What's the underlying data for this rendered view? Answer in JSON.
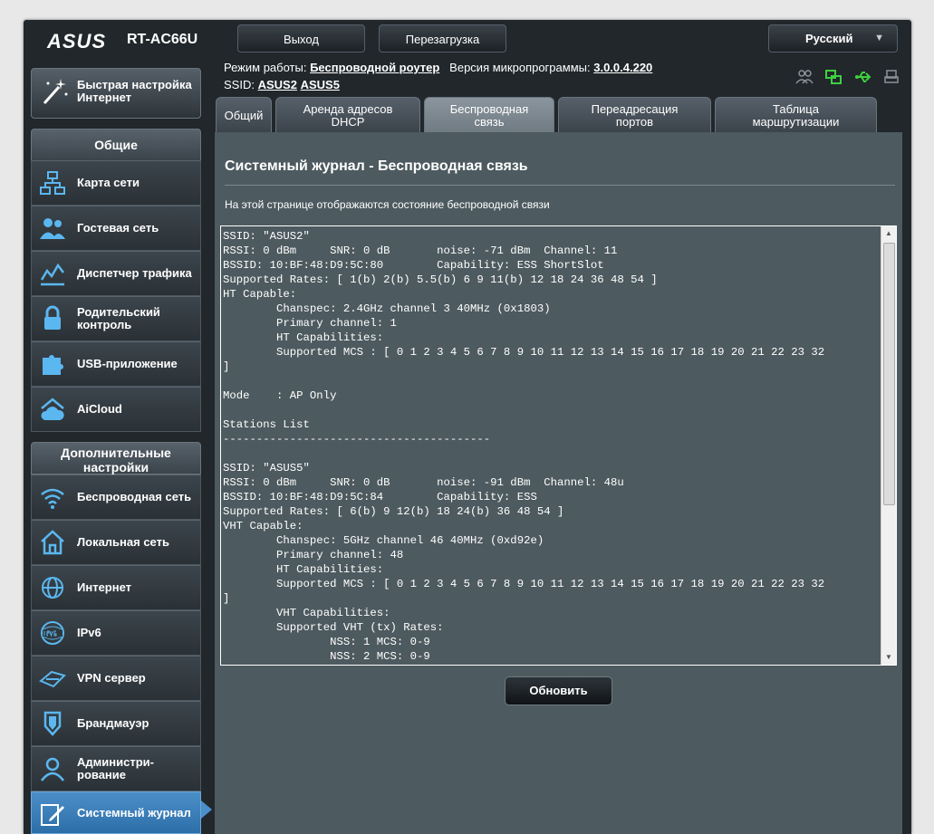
{
  "header": {
    "brand": "ASUS",
    "model": "RT-AC66U",
    "logout_label": "Выход",
    "reboot_label": "Перезагрузка",
    "language": "Русский"
  },
  "info": {
    "mode_label": "Режим работы:",
    "mode_value": "Беспроводной роутер",
    "firmware_label": "Версия микропрограммы:",
    "firmware_value": "3.0.0.4.220",
    "ssid_label": "SSID:",
    "ssid1": "ASUS2",
    "ssid2": "ASUS5"
  },
  "quick_setup": "Быстрая настройка Интернет",
  "sidebar": {
    "general_title": "Общие",
    "general_items": [
      {
        "label": "Карта сети",
        "icon": "network-map-icon"
      },
      {
        "label": "Гостевая сеть",
        "icon": "guest-network-icon"
      },
      {
        "label": "Диспетчер трафика",
        "icon": "traffic-manager-icon"
      },
      {
        "label": "Родительский контроль",
        "icon": "parental-control-icon"
      },
      {
        "label": "USB-приложение",
        "icon": "usb-app-icon"
      },
      {
        "label": "AiCloud",
        "icon": "aicloud-icon"
      }
    ],
    "advanced_title": "Дополнительные настройки",
    "advanced_items": [
      {
        "label": "Беспроводная сеть",
        "icon": "wireless-icon"
      },
      {
        "label": "Локальная сеть",
        "icon": "lan-icon"
      },
      {
        "label": "Интернет",
        "icon": "internet-icon"
      },
      {
        "label": "IPv6",
        "icon": "ipv6-icon"
      },
      {
        "label": "VPN сервер",
        "icon": "vpn-icon"
      },
      {
        "label": "Брандмауэр",
        "icon": "firewall-icon"
      },
      {
        "label": "Администри-рование",
        "icon": "administration-icon"
      },
      {
        "label": "Системный журнал",
        "icon": "system-log-icon"
      }
    ]
  },
  "tabs": [
    {
      "label": "Общий"
    },
    {
      "label": "Аренда адресов DHCP"
    },
    {
      "label": "Беспроводная связь"
    },
    {
      "label": "Переадресация портов"
    },
    {
      "label": "Таблица маршрутизации"
    }
  ],
  "content": {
    "title": "Системный журнал - Беспроводная связь",
    "description": "На этой странице отображаются состояние беспроводной связи",
    "log": "SSID: \"ASUS2\"\nRSSI: 0 dBm     SNR: 0 dB       noise: -71 dBm  Channel: 11\nBSSID: 10:BF:48:D9:5C:80        Capability: ESS ShortSlot\nSupported Rates: [ 1(b) 2(b) 5.5(b) 6 9 11(b) 12 18 24 36 48 54 ]\nHT Capable:\n        Chanspec: 2.4GHz channel 3 40MHz (0x1803)\n        Primary channel: 1\n        HT Capabilities:\n        Supported MCS : [ 0 1 2 3 4 5 6 7 8 9 10 11 12 13 14 15 16 17 18 19 20 21 22 23 32\n]\n\nMode    : AP Only\n\nStations List\n----------------------------------------\n\nSSID: \"ASUS5\"\nRSSI: 0 dBm     SNR: 0 dB       noise: -91 dBm  Channel: 48u\nBSSID: 10:BF:48:D9:5C:84        Capability: ESS\nSupported Rates: [ 6(b) 9 12(b) 18 24(b) 36 48 54 ]\nVHT Capable:\n        Chanspec: 5GHz channel 46 40MHz (0xd92e)\n        Primary channel: 48\n        HT Capabilities:\n        Supported MCS : [ 0 1 2 3 4 5 6 7 8 9 10 11 12 13 14 15 16 17 18 19 20 21 22 23 32\n]\n        VHT Capabilities:\n        Supported VHT (tx) Rates:\n                NSS: 1 MCS: 0-9\n                NSS: 2 MCS: 0-9",
    "refresh_label": "Обновить"
  }
}
